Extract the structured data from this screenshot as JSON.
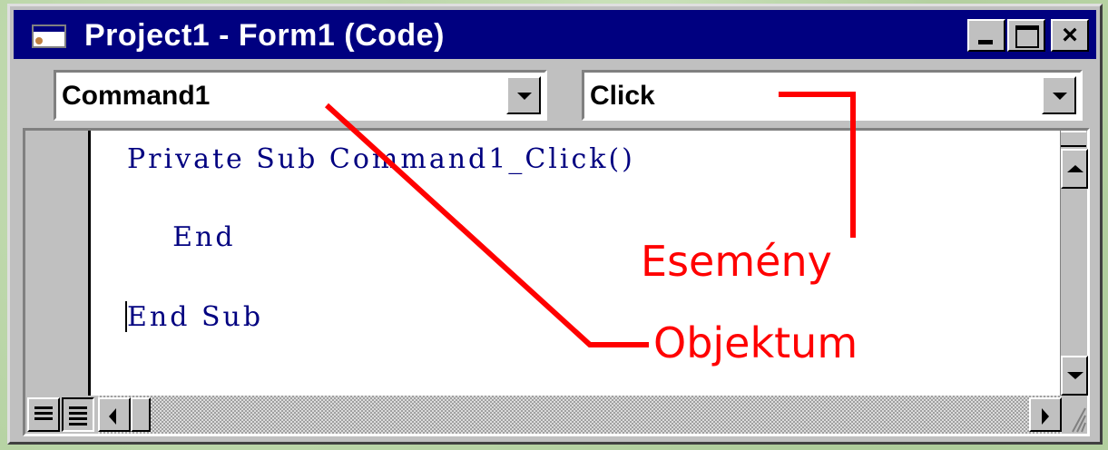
{
  "window": {
    "title": "Project1 - Form1 (Code)",
    "close_glyph": "×"
  },
  "object_combo": {
    "value": "Command1"
  },
  "procedure_combo": {
    "value": "Click"
  },
  "code": {
    "lines": [
      "Private Sub Command1_Click()",
      "    End",
      "End Sub"
    ]
  },
  "annotations": {
    "event_label": "Esemény",
    "object_label": "Objektum",
    "color": "#ff0000"
  },
  "colors": {
    "titlebar": "#000080",
    "code_keyword": "#000080",
    "chrome": "#c0c0c0"
  }
}
